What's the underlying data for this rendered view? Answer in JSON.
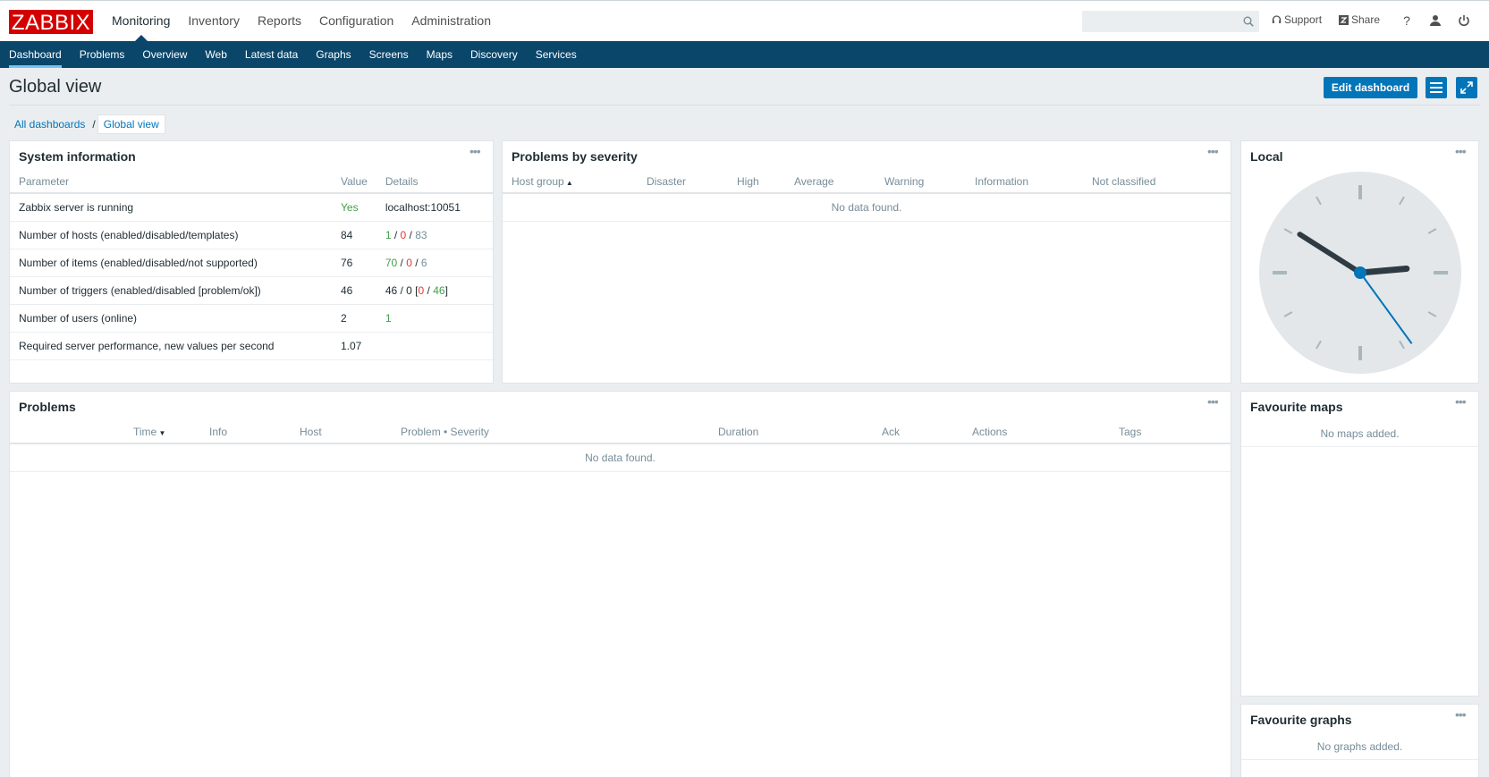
{
  "header": {
    "logo": "ZABBIX",
    "menu": [
      {
        "label": "Monitoring",
        "active": true
      },
      {
        "label": "Inventory"
      },
      {
        "label": "Reports"
      },
      {
        "label": "Configuration"
      },
      {
        "label": "Administration"
      }
    ],
    "search_value": "",
    "support_label": "Support",
    "share_label": "Share",
    "help_label": "?"
  },
  "subnav": [
    {
      "label": "Dashboard",
      "active": true
    },
    {
      "label": "Problems"
    },
    {
      "label": "Overview"
    },
    {
      "label": "Web"
    },
    {
      "label": "Latest data"
    },
    {
      "label": "Graphs"
    },
    {
      "label": "Screens"
    },
    {
      "label": "Maps"
    },
    {
      "label": "Discovery"
    },
    {
      "label": "Services"
    }
  ],
  "page": {
    "title": "Global view",
    "edit_button": "Edit dashboard",
    "breadcrumb": {
      "root": "All dashboards",
      "separator": "/",
      "current": "Global view"
    }
  },
  "system_info": {
    "title": "System information",
    "columns": [
      "Parameter",
      "Value",
      "Details"
    ],
    "rows": [
      {
        "param": "Zabbix server is running",
        "value": "Yes",
        "details": [
          {
            "text": "localhost:10051",
            "color": "default"
          }
        ]
      },
      {
        "param": "Number of hosts (enabled/disabled/templates)",
        "value": "84",
        "details": [
          {
            "text": "1",
            "color": "green"
          },
          {
            "text": " / ",
            "color": "default"
          },
          {
            "text": "0",
            "color": "red"
          },
          {
            "text": " / ",
            "color": "default"
          },
          {
            "text": "83",
            "color": "grey"
          }
        ]
      },
      {
        "param": "Number of items (enabled/disabled/not supported)",
        "value": "76",
        "details": [
          {
            "text": "70",
            "color": "green"
          },
          {
            "text": " / ",
            "color": "default"
          },
          {
            "text": "0",
            "color": "red"
          },
          {
            "text": " / ",
            "color": "default"
          },
          {
            "text": "6",
            "color": "grey"
          }
        ]
      },
      {
        "param": "Number of triggers (enabled/disabled [problem/ok])",
        "value": "46",
        "details": [
          {
            "text": "46 / 0 [",
            "color": "default"
          },
          {
            "text": "0",
            "color": "red"
          },
          {
            "text": " / ",
            "color": "default"
          },
          {
            "text": "46",
            "color": "green"
          },
          {
            "text": "]",
            "color": "default"
          }
        ]
      },
      {
        "param": "Number of users (online)",
        "value": "2",
        "details": [
          {
            "text": "1",
            "color": "green"
          }
        ]
      },
      {
        "param": "Required server performance, new values per second",
        "value": "1.07",
        "details": []
      }
    ]
  },
  "problems_by_severity": {
    "title": "Problems by severity",
    "columns": [
      "Host group",
      "Disaster",
      "High",
      "Average",
      "Warning",
      "Information",
      "Not classified"
    ],
    "empty": "No data found."
  },
  "clock": {
    "title": "Local",
    "hour": 2,
    "minute": 50,
    "second": 24
  },
  "problems": {
    "title": "Problems",
    "columns": [
      "Time",
      "Info",
      "Host",
      "Problem • Severity",
      "Duration",
      "Ack",
      "Actions",
      "Tags"
    ],
    "empty": "No data found."
  },
  "favourite_maps": {
    "title": "Favourite maps",
    "empty": "No maps added."
  },
  "favourite_graphs": {
    "title": "Favourite graphs",
    "empty": "No graphs added."
  },
  "colors": {
    "brand": "#d40000",
    "nav": "#0a466a",
    "accent": "#0275b8",
    "ok": "#429e47",
    "problem": "#e33734"
  }
}
